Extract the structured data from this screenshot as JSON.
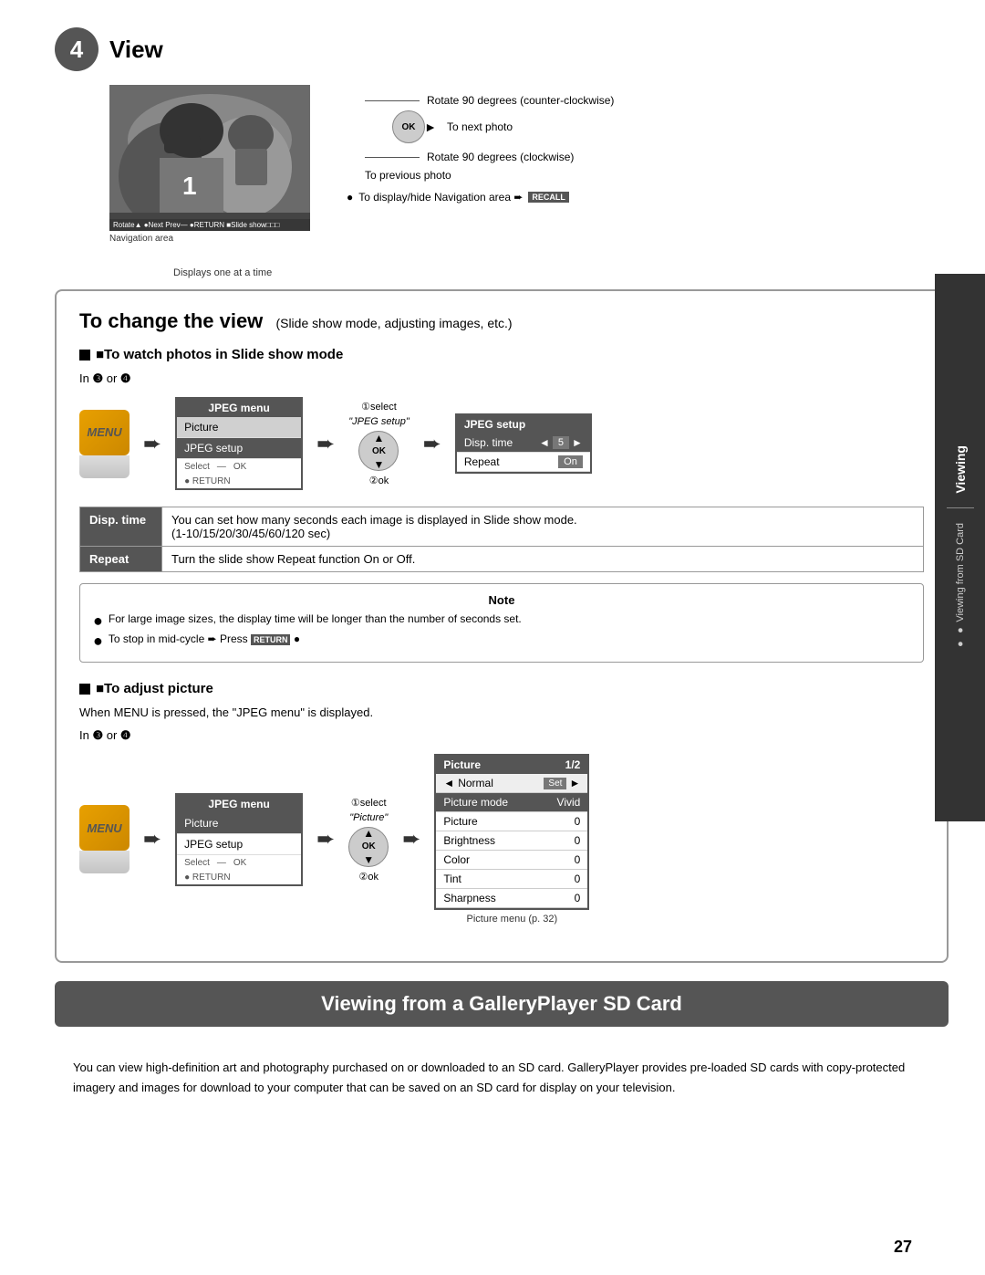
{
  "page": {
    "number": "27"
  },
  "section4": {
    "step": "4",
    "title": "View",
    "football_alt": "Football player photo",
    "nav_area_label": "Navigation area",
    "displays_one_at_a_time": "Displays one at a time",
    "rotate_ccw": "Rotate 90 degrees (counter-clockwise)",
    "to_next_photo": "To next photo",
    "rotate_cw": "Rotate 90 degrees (clockwise)",
    "to_prev_photo": "To previous photo",
    "nav_hint": "● To display/hide Navigation area ➨",
    "recall_label": "RECALL"
  },
  "change_view": {
    "title": "To change the view",
    "subtitle": "(Slide show mode, adjusting images, etc.)",
    "slide_show_title": "■To watch photos in Slide show mode",
    "in_label": "In ❸ or ❹",
    "jpeg_menu_title": "JPEG menu",
    "picture_item": "Picture",
    "jpeg_setup_item": "JPEG setup",
    "select_label": "Select",
    "ok_label": "OK",
    "return_label": "● RETURN",
    "select_1": "①select",
    "jpeg_setup_quote": "\"JPEG setup\"",
    "ok_2": "②ok",
    "jpeg_setup_title": "JPEG setup",
    "disp_time_label": "Disp. time",
    "disp_time_value": "5",
    "repeat_label": "Repeat",
    "repeat_value": "On",
    "disp_time_desc_label": "Disp. time",
    "disp_time_desc": "You can set how many seconds each image is displayed in Slide show mode.",
    "disp_time_secs": "(1-10/15/20/30/45/60/120 sec)",
    "repeat_desc_label": "Repeat",
    "repeat_desc": "Turn the slide show Repeat function On or Off.",
    "note_title": "Note",
    "note_1": "For large image sizes, the display time will be longer than the number of seconds set.",
    "note_2": "To stop in mid-cycle ➨ Press RETURN",
    "adjust_title": "■To adjust picture",
    "adjust_desc": "When MENU is pressed, the \"JPEG menu\" is displayed.",
    "in_label_2": "In ❸ or ❹",
    "jpeg_menu_title_2": "JPEG menu",
    "picture_item_2": "Picture",
    "jpeg_setup_item_2": "JPEG setup",
    "select_label_2": "Select",
    "ok_label_2": "OK",
    "return_label_2": "● RETURN",
    "select_1_2": "①select",
    "picture_quote": "\"Picture\"",
    "ok_2_2": "②ok",
    "picture_setup_title": "Picture",
    "picture_page": "1/2",
    "normal_label": "Normal",
    "set_label": "Set",
    "picture_mode_label": "Picture mode",
    "picture_mode_value": "Vivid",
    "picture_label": "Picture",
    "picture_val": "0",
    "brightness_label": "Brightness",
    "brightness_val": "0",
    "color_label": "Color",
    "color_val": "0",
    "tint_label": "Tint",
    "tint_val": "0",
    "sharpness_label": "Sharpness",
    "sharpness_val": "0",
    "pic_menu_caption": "Picture menu (p. 32)"
  },
  "sd_card": {
    "title": "Viewing from a GalleryPlayer SD Card",
    "body": "You can view high-definition art and photography purchased on or downloaded to an SD card. GalleryPlayer provides pre-loaded SD cards with copy-protected imagery and images for download to your computer that can be saved on an SD card for display on your television."
  },
  "sidebar": {
    "main_text": "Viewing",
    "sub_text": "● Viewing from SD Card"
  }
}
